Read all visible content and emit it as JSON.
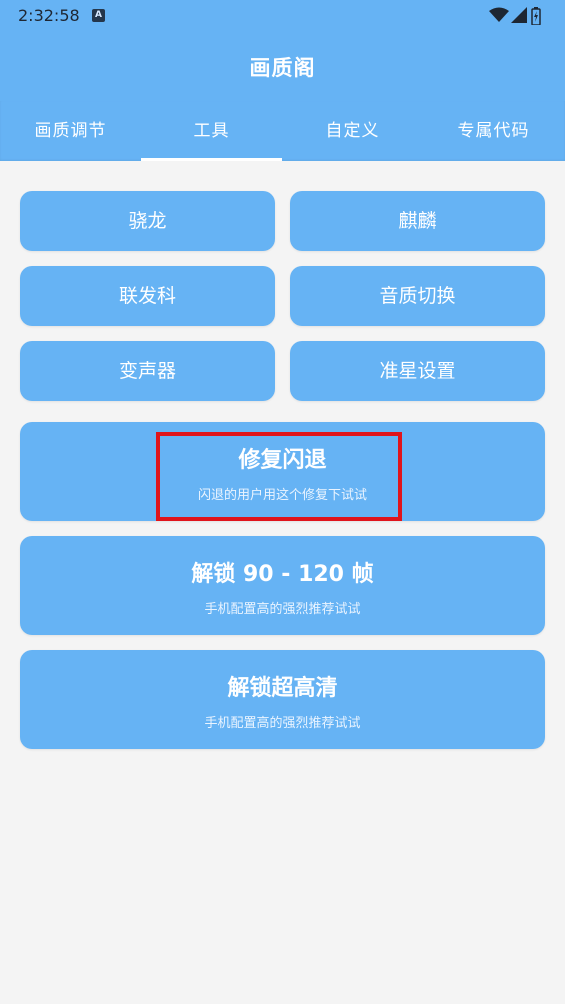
{
  "status_bar": {
    "time": "2:32:58",
    "app_icon_letter": "A"
  },
  "app_bar": {
    "title": "画质阁"
  },
  "tabs": [
    {
      "label": "画质调节",
      "selected": false
    },
    {
      "label": "工具",
      "selected": true
    },
    {
      "label": "自定义",
      "selected": false
    },
    {
      "label": "专属代码",
      "selected": false
    }
  ],
  "grid_buttons": [
    {
      "label": "骁龙"
    },
    {
      "label": "麒麟"
    },
    {
      "label": "联发科"
    },
    {
      "label": "音质切换"
    },
    {
      "label": "变声器"
    },
    {
      "label": "准星设置"
    }
  ],
  "large_buttons": [
    {
      "title": "修复闪退",
      "subtitle": "闪退的用户用这个修复下试试"
    },
    {
      "title": "解锁 90 - 120 帧",
      "subtitle": "手机配置高的强烈推荐试试"
    },
    {
      "title": "解锁超高清",
      "subtitle": "手机配置高的强烈推荐试试"
    }
  ],
  "colors": {
    "primary": "#66b3f4",
    "background": "#f4f4f4",
    "highlight": "#e0141b"
  }
}
